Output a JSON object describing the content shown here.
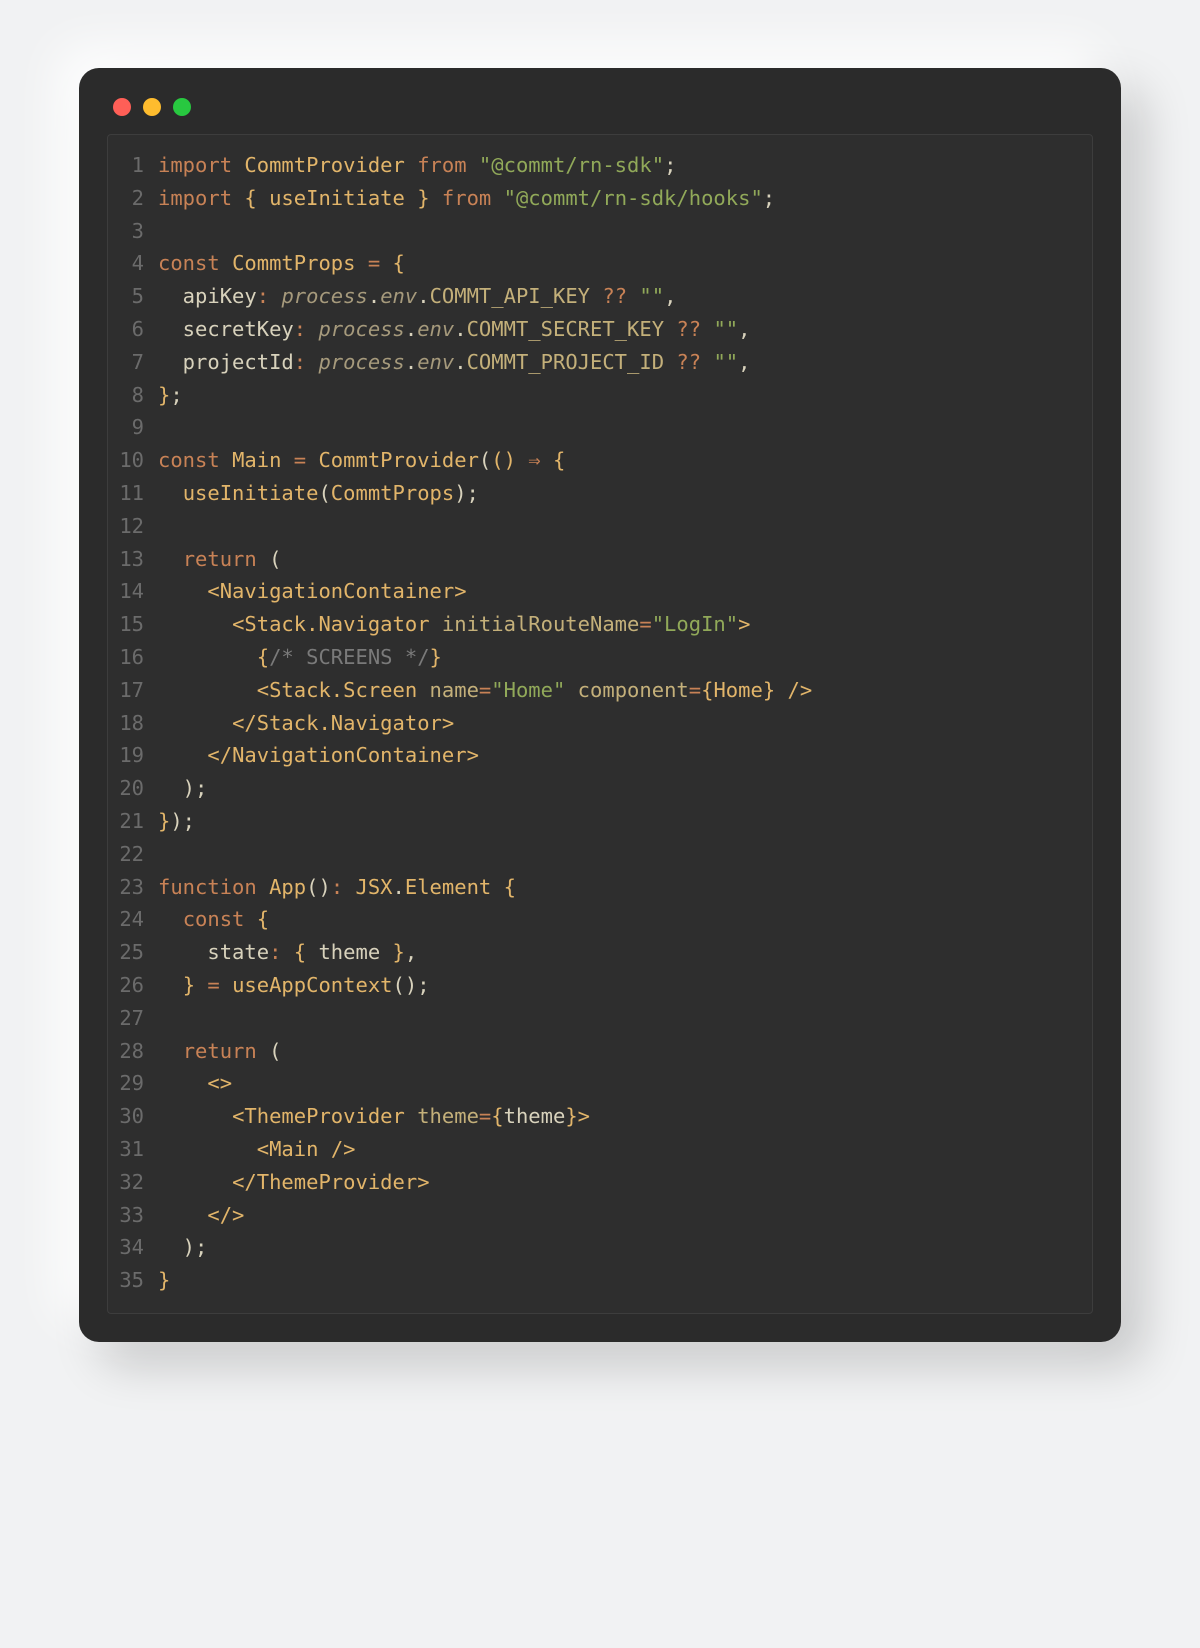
{
  "dots": [
    "red",
    "yellow",
    "green"
  ],
  "lines": [
    {
      "n": 1,
      "tokens": [
        [
          "kw",
          "import"
        ],
        [
          "pl",
          " "
        ],
        [
          "ty",
          "CommtProvider"
        ],
        [
          "pl",
          " "
        ],
        [
          "kw",
          "from"
        ],
        [
          "pl",
          " "
        ],
        [
          "s",
          "\"@commt/rn-sdk\""
        ],
        [
          "pl",
          ";"
        ]
      ]
    },
    {
      "n": 2,
      "tokens": [
        [
          "kw",
          "import"
        ],
        [
          "pl",
          " "
        ],
        [
          "cu",
          "{"
        ],
        [
          "pl",
          " "
        ],
        [
          "ty",
          "useInitiate"
        ],
        [
          "pl",
          " "
        ],
        [
          "cu",
          "}"
        ],
        [
          "pl",
          " "
        ],
        [
          "kw",
          "from"
        ],
        [
          "pl",
          " "
        ],
        [
          "s",
          "\"@commt/rn-sdk/hooks\""
        ],
        [
          "pl",
          ";"
        ]
      ]
    },
    {
      "n": 3,
      "tokens": [
        [
          "pl",
          ""
        ]
      ]
    },
    {
      "n": 4,
      "tokens": [
        [
          "kw",
          "const"
        ],
        [
          "pl",
          " "
        ],
        [
          "cn",
          "CommtProps"
        ],
        [
          "pl",
          " "
        ],
        [
          "op",
          "="
        ],
        [
          "pl",
          " "
        ],
        [
          "cu",
          "{"
        ]
      ]
    },
    {
      "n": 5,
      "tokens": [
        [
          "pl",
          "  apiKey"
        ],
        [
          "op",
          ":"
        ],
        [
          "pl",
          " "
        ],
        [
          "i",
          "process"
        ],
        [
          "pl",
          "."
        ],
        [
          "i",
          "env"
        ],
        [
          "pl",
          "."
        ],
        [
          "env",
          "COMMT_API_KEY"
        ],
        [
          "pl",
          " "
        ],
        [
          "op",
          "??"
        ],
        [
          "pl",
          " "
        ],
        [
          "s",
          "\"\""
        ],
        [
          "pl",
          ","
        ]
      ]
    },
    {
      "n": 6,
      "tokens": [
        [
          "pl",
          "  secretKey"
        ],
        [
          "op",
          ":"
        ],
        [
          "pl",
          " "
        ],
        [
          "i",
          "process"
        ],
        [
          "pl",
          "."
        ],
        [
          "i",
          "env"
        ],
        [
          "pl",
          "."
        ],
        [
          "env",
          "COMMT_SECRET_KEY"
        ],
        [
          "pl",
          " "
        ],
        [
          "op",
          "??"
        ],
        [
          "pl",
          " "
        ],
        [
          "s",
          "\"\""
        ],
        [
          "pl",
          ","
        ]
      ]
    },
    {
      "n": 7,
      "tokens": [
        [
          "pl",
          "  projectId"
        ],
        [
          "op",
          ":"
        ],
        [
          "pl",
          " "
        ],
        [
          "i",
          "process"
        ],
        [
          "pl",
          "."
        ],
        [
          "i",
          "env"
        ],
        [
          "pl",
          "."
        ],
        [
          "env",
          "COMMT_PROJECT_ID"
        ],
        [
          "pl",
          " "
        ],
        [
          "op",
          "??"
        ],
        [
          "pl",
          " "
        ],
        [
          "s",
          "\"\""
        ],
        [
          "pl",
          ","
        ]
      ]
    },
    {
      "n": 8,
      "tokens": [
        [
          "cu",
          "}"
        ],
        [
          "pl",
          ";"
        ]
      ]
    },
    {
      "n": 9,
      "tokens": [
        [
          "pl",
          ""
        ]
      ]
    },
    {
      "n": 10,
      "tokens": [
        [
          "kw",
          "const"
        ],
        [
          "pl",
          " "
        ],
        [
          "cn",
          "Main"
        ],
        [
          "pl",
          " "
        ],
        [
          "op",
          "="
        ],
        [
          "pl",
          " "
        ],
        [
          "fn",
          "CommtProvider"
        ],
        [
          "pl",
          "("
        ],
        [
          "cu",
          "()"
        ],
        [
          "pl",
          " "
        ],
        [
          "op",
          "⇒"
        ],
        [
          "pl",
          " "
        ],
        [
          "cu",
          "{"
        ]
      ]
    },
    {
      "n": 11,
      "tokens": [
        [
          "pl",
          "  "
        ],
        [
          "fn",
          "useInitiate"
        ],
        [
          "pl",
          "("
        ],
        [
          "ty",
          "CommtProps"
        ],
        [
          "pl",
          ");"
        ]
      ]
    },
    {
      "n": 12,
      "tokens": [
        [
          "pl",
          ""
        ]
      ]
    },
    {
      "n": 13,
      "tokens": [
        [
          "pl",
          "  "
        ],
        [
          "kw",
          "return"
        ],
        [
          "pl",
          " ("
        ]
      ]
    },
    {
      "n": 14,
      "tokens": [
        [
          "pl",
          "    "
        ],
        [
          "cu",
          "<"
        ],
        [
          "tag",
          "NavigationContainer"
        ],
        [
          "cu",
          ">"
        ]
      ]
    },
    {
      "n": 15,
      "tokens": [
        [
          "pl",
          "      "
        ],
        [
          "cu",
          "<"
        ],
        [
          "tag",
          "Stack.Navigator"
        ],
        [
          "pl",
          " "
        ],
        [
          "attr",
          "initialRouteName"
        ],
        [
          "op",
          "="
        ],
        [
          "s",
          "\"LogIn\""
        ],
        [
          "cu",
          ">"
        ]
      ]
    },
    {
      "n": 16,
      "tokens": [
        [
          "pl",
          "        "
        ],
        [
          "cu",
          "{"
        ],
        [
          "cm",
          "/* SCREENS */"
        ],
        [
          "cu",
          "}"
        ]
      ]
    },
    {
      "n": 17,
      "tokens": [
        [
          "pl",
          "        "
        ],
        [
          "cu",
          "<"
        ],
        [
          "tag",
          "Stack.Screen"
        ],
        [
          "pl",
          " "
        ],
        [
          "attr",
          "name"
        ],
        [
          "op",
          "="
        ],
        [
          "s",
          "\"Home\""
        ],
        [
          "pl",
          " "
        ],
        [
          "attr",
          "component"
        ],
        [
          "op",
          "="
        ],
        [
          "cu",
          "{"
        ],
        [
          "ty",
          "Home"
        ],
        [
          "cu",
          "}"
        ],
        [
          "pl",
          " "
        ],
        [
          "cu",
          "/>"
        ]
      ]
    },
    {
      "n": 18,
      "tokens": [
        [
          "pl",
          "      "
        ],
        [
          "cu",
          "</"
        ],
        [
          "tag",
          "Stack.Navigator"
        ],
        [
          "cu",
          ">"
        ]
      ]
    },
    {
      "n": 19,
      "tokens": [
        [
          "pl",
          "    "
        ],
        [
          "cu",
          "</"
        ],
        [
          "tag",
          "NavigationContainer"
        ],
        [
          "cu",
          ">"
        ]
      ]
    },
    {
      "n": 20,
      "tokens": [
        [
          "pl",
          "  );"
        ]
      ]
    },
    {
      "n": 21,
      "tokens": [
        [
          "cu",
          "}"
        ],
        [
          "pl",
          ");"
        ]
      ]
    },
    {
      "n": 22,
      "tokens": [
        [
          "pl",
          ""
        ]
      ]
    },
    {
      "n": 23,
      "tokens": [
        [
          "kw",
          "function"
        ],
        [
          "pl",
          " "
        ],
        [
          "fn",
          "App"
        ],
        [
          "pl",
          "()"
        ],
        [
          "op",
          ":"
        ],
        [
          "pl",
          " "
        ],
        [
          "ty",
          "JSX"
        ],
        [
          "pl",
          "."
        ],
        [
          "ty",
          "Element"
        ],
        [
          "pl",
          " "
        ],
        [
          "cu",
          "{"
        ]
      ]
    },
    {
      "n": 24,
      "tokens": [
        [
          "pl",
          "  "
        ],
        [
          "kw",
          "const"
        ],
        [
          "pl",
          " "
        ],
        [
          "cu",
          "{"
        ]
      ]
    },
    {
      "n": 25,
      "tokens": [
        [
          "pl",
          "    state"
        ],
        [
          "op",
          ":"
        ],
        [
          "pl",
          " "
        ],
        [
          "cu",
          "{"
        ],
        [
          "pl",
          " theme "
        ],
        [
          "cu",
          "}"
        ],
        [
          "pl",
          ","
        ]
      ]
    },
    {
      "n": 26,
      "tokens": [
        [
          "pl",
          "  "
        ],
        [
          "cu",
          "}"
        ],
        [
          "pl",
          " "
        ],
        [
          "op",
          "="
        ],
        [
          "pl",
          " "
        ],
        [
          "fn",
          "useAppContext"
        ],
        [
          "pl",
          "();"
        ]
      ]
    },
    {
      "n": 27,
      "tokens": [
        [
          "pl",
          ""
        ]
      ]
    },
    {
      "n": 28,
      "tokens": [
        [
          "pl",
          "  "
        ],
        [
          "kw",
          "return"
        ],
        [
          "pl",
          " ("
        ]
      ]
    },
    {
      "n": 29,
      "tokens": [
        [
          "pl",
          "    "
        ],
        [
          "cu",
          "<>"
        ]
      ]
    },
    {
      "n": 30,
      "tokens": [
        [
          "pl",
          "      "
        ],
        [
          "cu",
          "<"
        ],
        [
          "tag",
          "ThemeProvider"
        ],
        [
          "pl",
          " "
        ],
        [
          "attr",
          "theme"
        ],
        [
          "op",
          "="
        ],
        [
          "cu",
          "{"
        ],
        [
          "pl",
          "theme"
        ],
        [
          "cu",
          "}"
        ],
        [
          "cu",
          ">"
        ]
      ]
    },
    {
      "n": 31,
      "tokens": [
        [
          "pl",
          "        "
        ],
        [
          "cu",
          "<"
        ],
        [
          "tag",
          "Main"
        ],
        [
          "pl",
          " "
        ],
        [
          "cu",
          "/>"
        ]
      ]
    },
    {
      "n": 32,
      "tokens": [
        [
          "pl",
          "      "
        ],
        [
          "cu",
          "</"
        ],
        [
          "tag",
          "ThemeProvider"
        ],
        [
          "cu",
          ">"
        ]
      ]
    },
    {
      "n": 33,
      "tokens": [
        [
          "pl",
          "    "
        ],
        [
          "cu",
          "</>"
        ]
      ]
    },
    {
      "n": 34,
      "tokens": [
        [
          "pl",
          "  );"
        ]
      ]
    },
    {
      "n": 35,
      "tokens": [
        [
          "cu",
          "}"
        ]
      ]
    }
  ]
}
